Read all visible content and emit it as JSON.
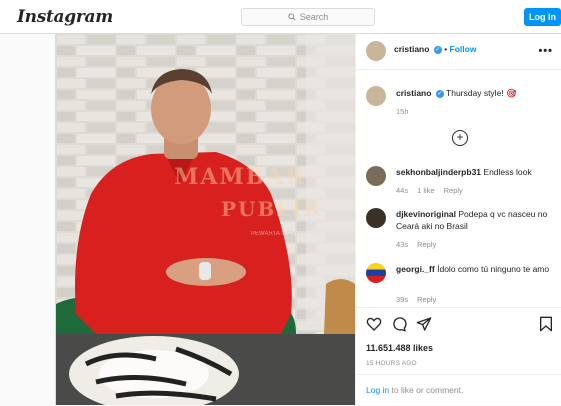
{
  "topbar": {
    "logo": "Instagram",
    "search_placeholder": "Search",
    "login_label": "Log In"
  },
  "post": {
    "author": "cristiano",
    "follow_label": "Follow",
    "caption": {
      "user": "cristiano",
      "text": "Thursday style! 🎯",
      "age": "15h"
    },
    "watermark_line1": "MAMBAR",
    "watermark_line2": "PUBLIK",
    "watermark_line3": "PEWARTA INFO",
    "comments": [
      {
        "user": "sekhonbaljinderpb31",
        "text": "Endless look",
        "age": "44s",
        "likes": "1 like",
        "reply": "Reply"
      },
      {
        "user": "djkevinoriginal",
        "text": "Podepa q vc nasceu no Ceará aki no Brasil",
        "age": "43s",
        "reply": "Reply"
      },
      {
        "user": "georgi._ff",
        "text": "Ídolo como tú ninguno te amo",
        "age": "39s",
        "reply": "Reply"
      }
    ],
    "likes": "11.651.488 likes",
    "posted_ago": "15 HOURS AGO",
    "login_link": "Log in",
    "login_rest": " to like or comment."
  },
  "colors": {
    "accent": "#0095f6",
    "shirt": "#d8201f"
  }
}
